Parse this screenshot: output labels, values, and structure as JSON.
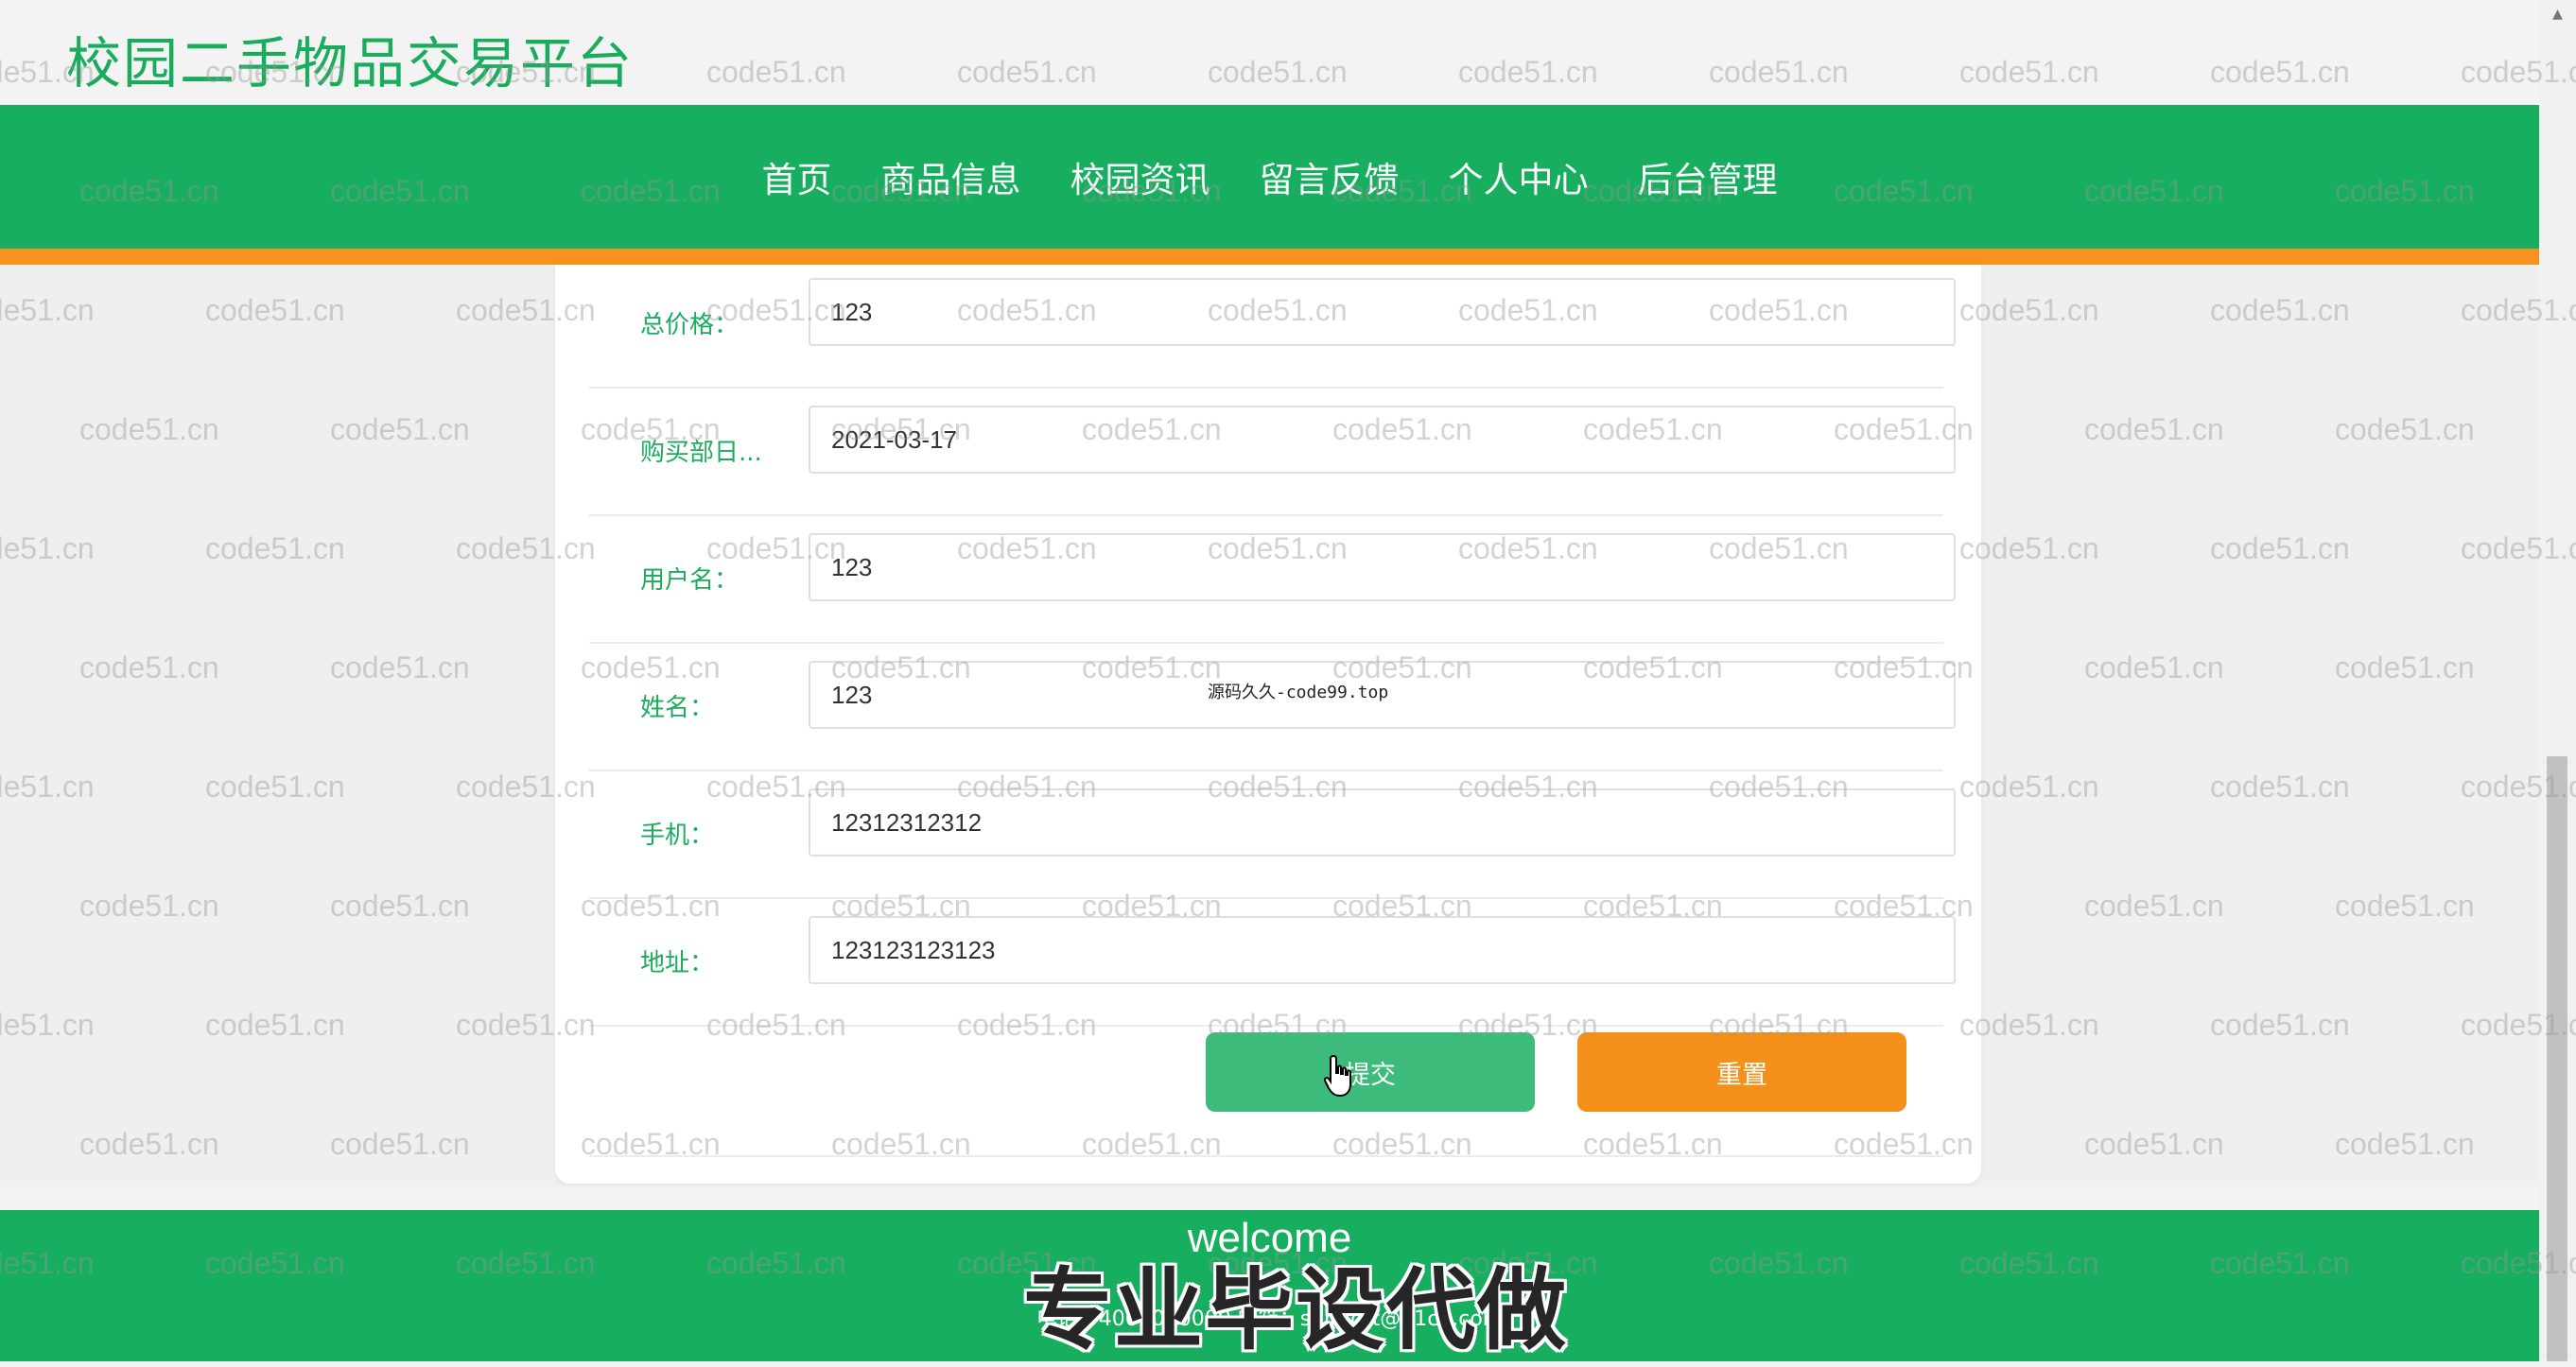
{
  "site": {
    "title": "校园二手物品交易平台"
  },
  "nav": {
    "items": [
      "首页",
      "商品信息",
      "校园资讯",
      "留言反馈",
      "个人中心",
      "后台管理"
    ]
  },
  "form": {
    "fields": [
      {
        "label": "总价格：",
        "value": "123"
      },
      {
        "label": "购买部日...",
        "value": "2021-03-17"
      },
      {
        "label": "用户名：",
        "value": "123"
      },
      {
        "label": "姓名：",
        "value": "123"
      },
      {
        "label": "手机：",
        "value": "12312312312"
      },
      {
        "label": "地址：",
        "value": "123123123123"
      }
    ],
    "submit_label": "提交",
    "reset_label": "重置"
  },
  "center_note": "源码久久-code99.top",
  "footer": {
    "welcome": "welcome",
    "contact": "电话：4008000000  邮箱：support@21cn.com"
  },
  "overlay": {
    "text": "专业毕设代做"
  },
  "watermark": {
    "text": "code51.cn"
  },
  "colors": {
    "primary": "#17ae60",
    "accent": "#f7921e",
    "submit": "#3dbb7b",
    "reset": "#f4901a"
  },
  "icons": {
    "cursor": "hand-pointer-icon",
    "scroll_up": "chevron-up-icon"
  }
}
